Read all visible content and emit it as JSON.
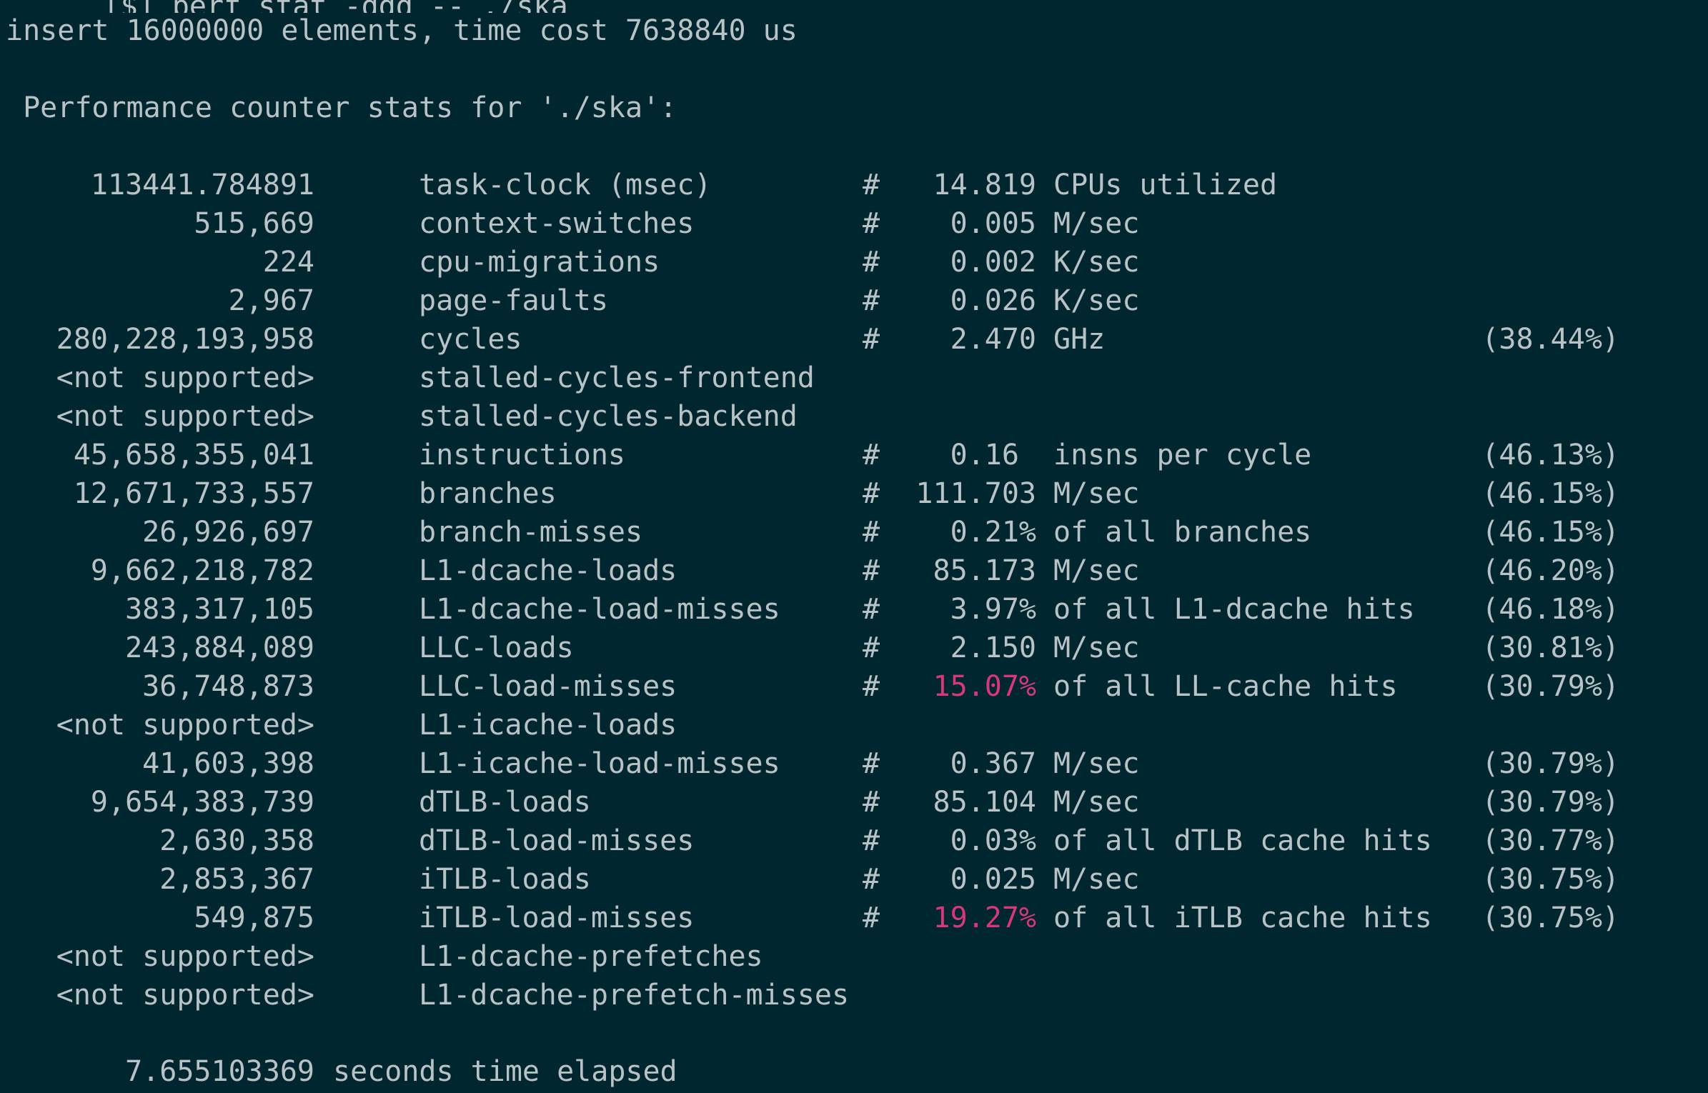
{
  "terminal": {
    "prompt_line": "  [$] perf stat -ddd -- ./ska",
    "output_line": "insert 16000000 elements, time cost 7638840 us",
    "header": " Performance counter stats for './ska':",
    "rows": [
      {
        "count": "113441.784891",
        "event": "task-clock (msec)",
        "hash": "#",
        "metric": "14.819",
        "desc": "CPUs utilized",
        "pct": "",
        "highlight": false
      },
      {
        "count": "515,669",
        "event": "context-switches",
        "hash": "#",
        "metric": "0.005",
        "desc": "M/sec",
        "pct": "",
        "highlight": false
      },
      {
        "count": "224",
        "event": "cpu-migrations",
        "hash": "#",
        "metric": "0.002",
        "desc": "K/sec",
        "pct": "",
        "highlight": false
      },
      {
        "count": "2,967",
        "event": "page-faults",
        "hash": "#",
        "metric": "0.026",
        "desc": "K/sec",
        "pct": "",
        "highlight": false
      },
      {
        "count": "280,228,193,958",
        "event": "cycles",
        "hash": "#",
        "metric": "2.470",
        "desc": "GHz",
        "pct": "(38.44%)",
        "highlight": false
      },
      {
        "count": "<not supported>",
        "event": "stalled-cycles-frontend",
        "hash": "",
        "metric": "",
        "desc": "",
        "pct": "",
        "highlight": false
      },
      {
        "count": "<not supported>",
        "event": "stalled-cycles-backend",
        "hash": "",
        "metric": "",
        "desc": "",
        "pct": "",
        "highlight": false
      },
      {
        "count": "45,658,355,041",
        "event": "instructions",
        "hash": "#",
        "metric": "0.16 ",
        "desc": "insns per cycle",
        "pct": "(46.13%)",
        "highlight": false
      },
      {
        "count": "12,671,733,557",
        "event": "branches",
        "hash": "#",
        "metric": "111.703",
        "desc": "M/sec",
        "pct": "(46.15%)",
        "highlight": false
      },
      {
        "count": "26,926,697",
        "event": "branch-misses",
        "hash": "#",
        "metric": "0.21%",
        "desc": "of all branches",
        "pct": "(46.15%)",
        "highlight": false
      },
      {
        "count": "9,662,218,782",
        "event": "L1-dcache-loads",
        "hash": "#",
        "metric": "85.173",
        "desc": "M/sec",
        "pct": "(46.20%)",
        "highlight": false
      },
      {
        "count": "383,317,105",
        "event": "L1-dcache-load-misses",
        "hash": "#",
        "metric": "3.97%",
        "desc": "of all L1-dcache hits",
        "pct": "(46.18%)",
        "highlight": false
      },
      {
        "count": "243,884,089",
        "event": "LLC-loads",
        "hash": "#",
        "metric": "2.150",
        "desc": "M/sec",
        "pct": "(30.81%)",
        "highlight": false
      },
      {
        "count": "36,748,873",
        "event": "LLC-load-misses",
        "hash": "#",
        "metric": "15.07%",
        "desc": "of all LL-cache hits",
        "pct": "(30.79%)",
        "highlight": true
      },
      {
        "count": "<not supported>",
        "event": "L1-icache-loads",
        "hash": "",
        "metric": "",
        "desc": "",
        "pct": "",
        "highlight": false
      },
      {
        "count": "41,603,398",
        "event": "L1-icache-load-misses",
        "hash": "#",
        "metric": "0.367",
        "desc": "M/sec",
        "pct": "(30.79%)",
        "highlight": false
      },
      {
        "count": "9,654,383,739",
        "event": "dTLB-loads",
        "hash": "#",
        "metric": "85.104",
        "desc": "M/sec",
        "pct": "(30.79%)",
        "highlight": false
      },
      {
        "count": "2,630,358",
        "event": "dTLB-load-misses",
        "hash": "#",
        "metric": "0.03%",
        "desc": "of all dTLB cache hits",
        "pct": "(30.77%)",
        "highlight": false
      },
      {
        "count": "2,853,367",
        "event": "iTLB-loads",
        "hash": "#",
        "metric": "0.025",
        "desc": "M/sec",
        "pct": "(30.75%)",
        "highlight": false
      },
      {
        "count": "549,875",
        "event": "iTLB-load-misses",
        "hash": "#",
        "metric": "19.27%",
        "desc": "of all iTLB cache hits",
        "pct": "(30.75%)",
        "highlight": true
      },
      {
        "count": "<not supported>",
        "event": "L1-dcache-prefetches",
        "hash": "",
        "metric": "",
        "desc": "",
        "pct": "",
        "highlight": false
      },
      {
        "count": "<not supported>",
        "event": "L1-dcache-prefetch-misses",
        "hash": "",
        "metric": "",
        "desc": "",
        "pct": "",
        "highlight": false
      }
    ],
    "elapsed_value": "7.655103369",
    "elapsed_label": "seconds time elapsed",
    "colors": {
      "background": "#00262f",
      "text": "#b9c2c4",
      "highlight": "#d6387a"
    }
  }
}
